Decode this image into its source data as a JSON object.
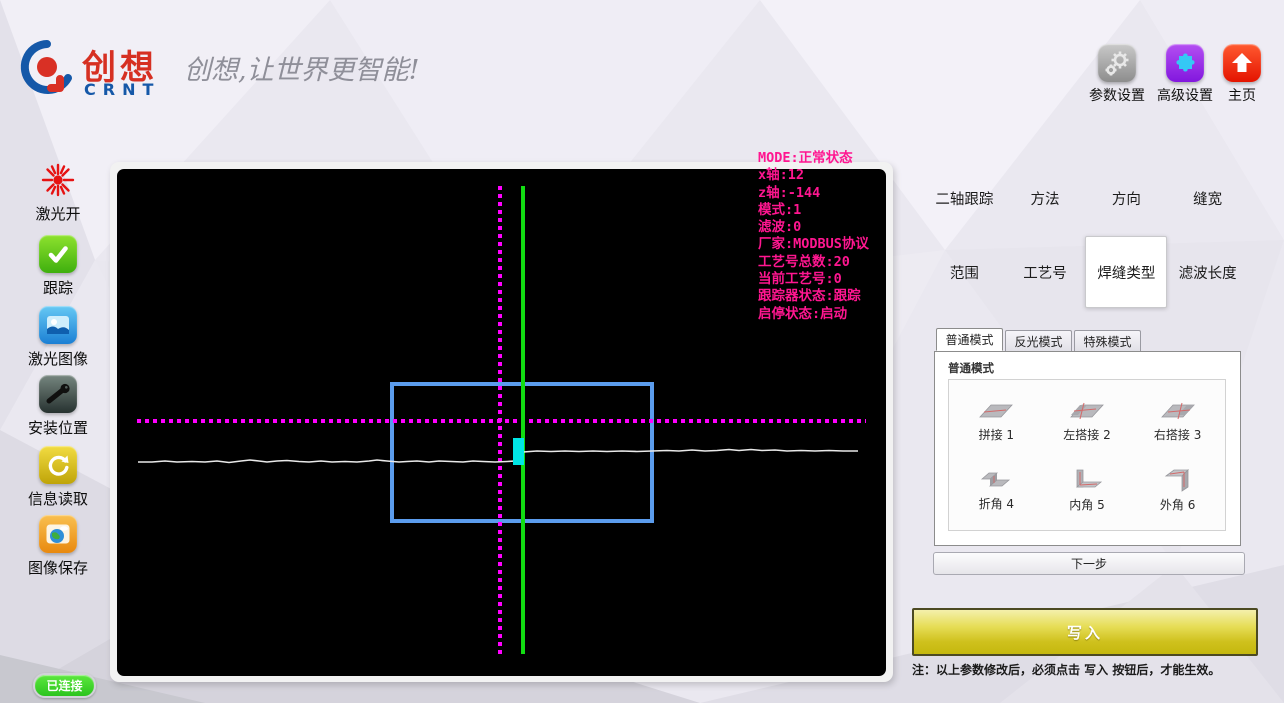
{
  "header": {
    "brand_cn": "创想",
    "brand_en": "CRNT",
    "slogan": "创想,让世界更智能!",
    "nav": [
      {
        "label": "参数设置",
        "icon": "gear-icon"
      },
      {
        "label": "高级设置",
        "icon": "puzzle-icon"
      },
      {
        "label": "主页",
        "icon": "home-icon"
      }
    ]
  },
  "sidebar": {
    "items": [
      {
        "label": "激光开",
        "icon": "laser-icon"
      },
      {
        "label": "跟踪",
        "icon": "check-icon"
      },
      {
        "label": "激光图像",
        "icon": "laser-image-icon"
      },
      {
        "label": "安装位置",
        "icon": "install-position-icon"
      },
      {
        "label": "信息读取",
        "icon": "info-read-icon"
      },
      {
        "label": "图像保存",
        "icon": "image-save-icon"
      }
    ]
  },
  "canvas": {
    "status_lines": [
      "MODE:正常状态",
      "x轴:12",
      "z轴:-144",
      "模式:1",
      "滤波:0",
      "厂家:MODBUS协议",
      "工艺号总数:20",
      "当前工艺号:0",
      "跟踪器状态:跟踪",
      "启停状态:启动"
    ],
    "colors": {
      "crosshair": "#ff00ff",
      "tracker_line": "#12dd12",
      "roi_box": "#5b9ced",
      "profile_line": "#e8e8e8",
      "seam_marker": "#00e6e6",
      "status_text": "#ff1690",
      "background": "#000000"
    }
  },
  "params": {
    "buttons": [
      "二轴跟踪",
      "方法",
      "方向",
      "缝宽",
      "范围",
      "工艺号",
      "焊缝类型",
      "滤波长度"
    ],
    "selected": "焊缝类型"
  },
  "mode_tabs": [
    {
      "label": "普通模式",
      "active": true
    },
    {
      "label": "反光模式",
      "active": false
    },
    {
      "label": "特殊模式",
      "active": false
    }
  ],
  "weld_panel": {
    "group_title": "普通模式",
    "types": [
      {
        "label": "拼接 1",
        "icon": "butt-joint-icon"
      },
      {
        "label": "左搭接 2",
        "icon": "left-lap-joint-icon"
      },
      {
        "label": "右搭接 3",
        "icon": "right-lap-joint-icon"
      },
      {
        "label": "折角 4",
        "icon": "bend-joint-icon"
      },
      {
        "label": "内角 5",
        "icon": "inner-corner-icon"
      },
      {
        "label": "外角 6",
        "icon": "outer-corner-icon"
      }
    ],
    "next_button": "下一步"
  },
  "write_section": {
    "write_button": "写入",
    "note": "注：以上参数修改后，必须点击 写入 按钮后，才能生效。"
  },
  "status_bar": {
    "connection": "已连接"
  }
}
